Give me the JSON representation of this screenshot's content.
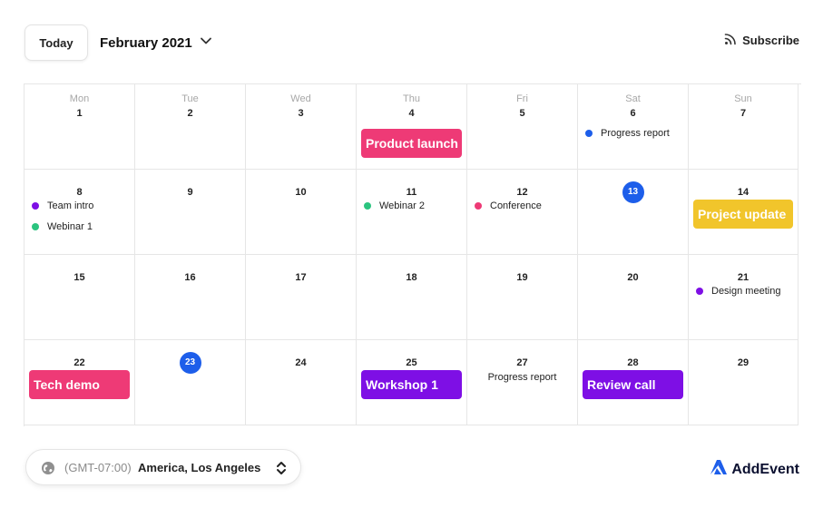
{
  "header": {
    "today_label": "Today",
    "month_label": "February 2021",
    "subscribe_label": "Subscribe"
  },
  "colors": {
    "accent": "#1d5eea",
    "pink": "#ee3a76",
    "purple": "#7e0fe5",
    "green": "#2bc47f",
    "yellow": "#f1c52b",
    "blue": "#1d5eea"
  },
  "calendar": {
    "weekdays": [
      "Mon",
      "Tue",
      "Wed",
      "Thu",
      "Fri",
      "Sat",
      "Sun"
    ],
    "weeks": [
      [
        {
          "day": "1"
        },
        {
          "day": "2"
        },
        {
          "day": "3"
        },
        {
          "day": "4",
          "events": [
            {
              "title": "Product launch",
              "style": "block",
              "color": "#ee3a76"
            }
          ]
        },
        {
          "day": "5"
        },
        {
          "day": "6",
          "events": [
            {
              "title": "Progress report",
              "style": "dot",
              "color": "#1d5eea"
            }
          ]
        },
        {
          "day": "7"
        }
      ],
      [
        {
          "day": "8",
          "events": [
            {
              "title": "Team intro",
              "style": "dot",
              "color": "#7e0fe5"
            },
            {
              "title": "Webinar 1",
              "style": "dot",
              "color": "#2bc47f"
            }
          ]
        },
        {
          "day": "9"
        },
        {
          "day": "10"
        },
        {
          "day": "11",
          "events": [
            {
              "title": "Webinar 2",
              "style": "dot",
              "color": "#2bc47f"
            }
          ]
        },
        {
          "day": "12",
          "events": [
            {
              "title": "Conference",
              "style": "dot",
              "color": "#ee3a76"
            }
          ]
        },
        {
          "day": "13",
          "today": true
        },
        {
          "day": "14",
          "events": [
            {
              "title": "Project update",
              "style": "block",
              "color": "#f1c52b"
            }
          ]
        }
      ],
      [
        {
          "day": "15"
        },
        {
          "day": "16"
        },
        {
          "day": "17"
        },
        {
          "day": "18"
        },
        {
          "day": "19"
        },
        {
          "day": "20"
        },
        {
          "day": "21",
          "events": [
            {
              "title": "Design meeting",
              "style": "dot",
              "color": "#7e0fe5"
            }
          ]
        }
      ],
      [
        {
          "day": "22",
          "events": [
            {
              "title": "Tech demo",
              "style": "block",
              "color": "#ee3a76"
            }
          ]
        },
        {
          "day": "23",
          "today": true
        },
        {
          "day": "24"
        },
        {
          "day": "25",
          "events": [
            {
              "title": "Workshop 1",
              "style": "block",
              "color": "#7e0fe5"
            }
          ]
        },
        {
          "day": "27",
          "events": [
            {
              "title": "Progress report",
              "style": "plain"
            }
          ]
        },
        {
          "day": "28",
          "events": [
            {
              "title": "Review call",
              "style": "block",
              "color": "#7e0fe5"
            }
          ]
        },
        {
          "day": "29"
        }
      ]
    ]
  },
  "timezone": {
    "offset": "(GMT-07:00)",
    "city": "America, Los Angeles"
  },
  "brand": {
    "name": "AddEvent",
    "icon": "addevent-logo-icon"
  },
  "icons": {
    "month_dropdown": "chevron-down-icon",
    "subscribe": "rss-icon",
    "timezone": "globe-icon",
    "timezone_select": "up-down-chevron-icon"
  }
}
